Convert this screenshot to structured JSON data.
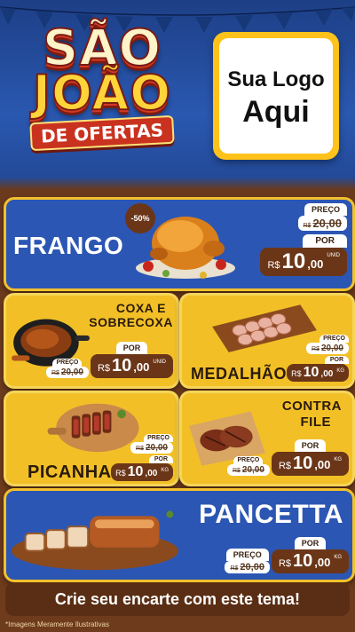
{
  "header": {
    "title_line1": "SÃO",
    "title_line2": "JOÃO",
    "title_line3": "DE OFERTAS",
    "logo_line1": "Sua Logo",
    "logo_line2": "Aqui"
  },
  "products": [
    {
      "name": "FRANGO",
      "discount": "-50%",
      "label_preco": "PREÇO",
      "label_por": "POR",
      "old_currency": "R$",
      "old_price": "20,00",
      "currency": "R$",
      "price_int": "10",
      "price_dec": ",00",
      "unit": "UNID"
    },
    {
      "name_line1": "COXA E",
      "name_line2": "SOBRECOXA",
      "label_preco": "PREÇO",
      "label_por": "POR",
      "old_currency": "R$",
      "old_price": "20,00",
      "currency": "R$",
      "price_int": "10",
      "price_dec": ",00",
      "unit": "UNID"
    },
    {
      "name": "MEDALHÃO",
      "label_preco": "PREÇO",
      "label_por": "POR",
      "old_currency": "R$",
      "old_price": "20,00",
      "currency": "R$",
      "price_int": "10",
      "price_dec": ",00",
      "unit": "KG"
    },
    {
      "name": "PICANHA",
      "label_preco": "PREÇO",
      "label_por": "POR",
      "old_currency": "R$",
      "old_price": "20,00",
      "currency": "R$",
      "price_int": "10",
      "price_dec": ",00",
      "unit": "KG"
    },
    {
      "name_line1": "CONTRA",
      "name_line2": "FILE",
      "label_preco": "PREÇO",
      "label_por": "POR",
      "old_currency": "R$",
      "old_price": "20,00",
      "currency": "R$",
      "price_int": "10",
      "price_dec": ",00",
      "unit": "KG"
    },
    {
      "name": "PANCETTA",
      "label_preco": "PREÇO",
      "label_por": "POR",
      "old_currency": "R$",
      "old_price": "20,00",
      "currency": "R$",
      "price_int": "10",
      "price_dec": ",00",
      "unit": "KG"
    }
  ],
  "footer": {
    "cta": "Crie seu encarte com este tema!",
    "note": "*Imagens Meramente Ilustrativas"
  },
  "colors": {
    "blue_panel": "#2c56b3",
    "yellow_panel": "#f2c026",
    "price_brown": "#6b3618",
    "wood": "#6e3b1c"
  }
}
